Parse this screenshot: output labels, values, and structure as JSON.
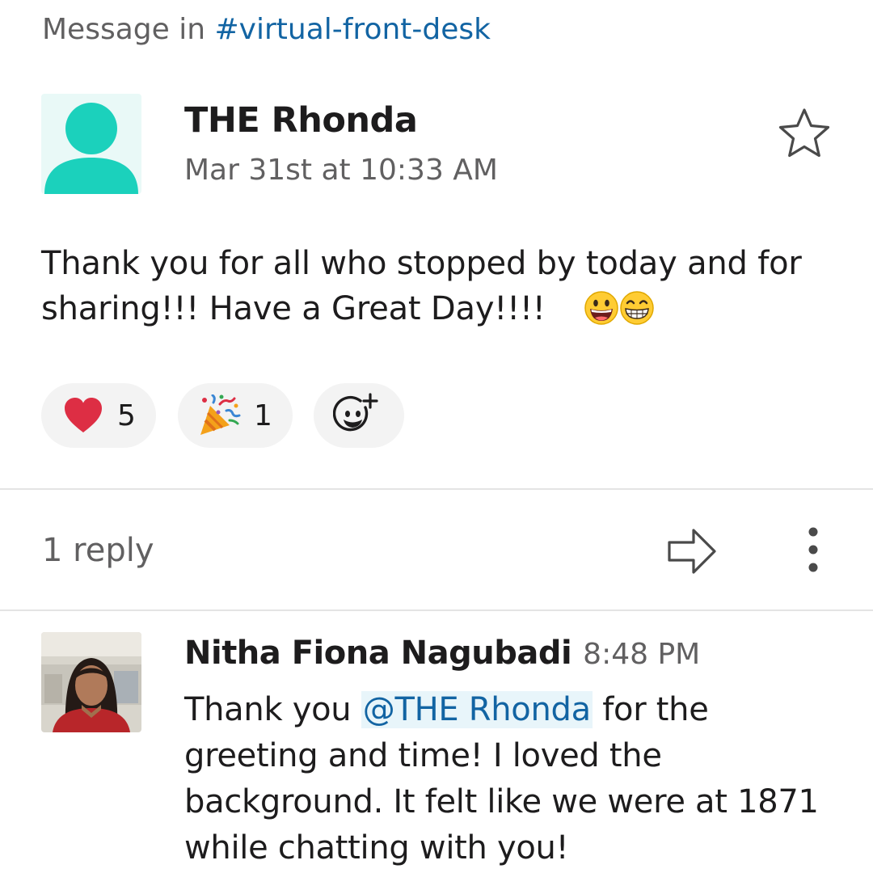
{
  "header": {
    "prefix": "Message in",
    "channel": "#virtual-front-desk"
  },
  "message": {
    "author": "THE Rhonda",
    "timestamp": "Mar 31st at 10:33 AM",
    "text": "Thank you for all who stopped by today and for sharing!!!  Have a Great Day!!!!",
    "inline_emojis": [
      "grinning-face-icon",
      "beaming-face-icon"
    ],
    "reactions": [
      {
        "icon": "heart-icon",
        "count": "5"
      },
      {
        "icon": "party-popper-icon",
        "count": "1"
      }
    ],
    "add_reaction_icon": "add-reaction-icon"
  },
  "thread": {
    "reply_count": "1 reply"
  },
  "reply": {
    "author": "Nitha Fiona Nagubadi",
    "time": "8:48 PM",
    "text_before": "Thank you ",
    "mention": "@THE Rhonda",
    "text_after": " for the greeting and time!  I loved the background. It felt like we were at 1871 while chatting with you!"
  },
  "colors": {
    "link": "#1264a3",
    "avatar_default": "#1bd1bc",
    "muted_text": "#616061"
  }
}
